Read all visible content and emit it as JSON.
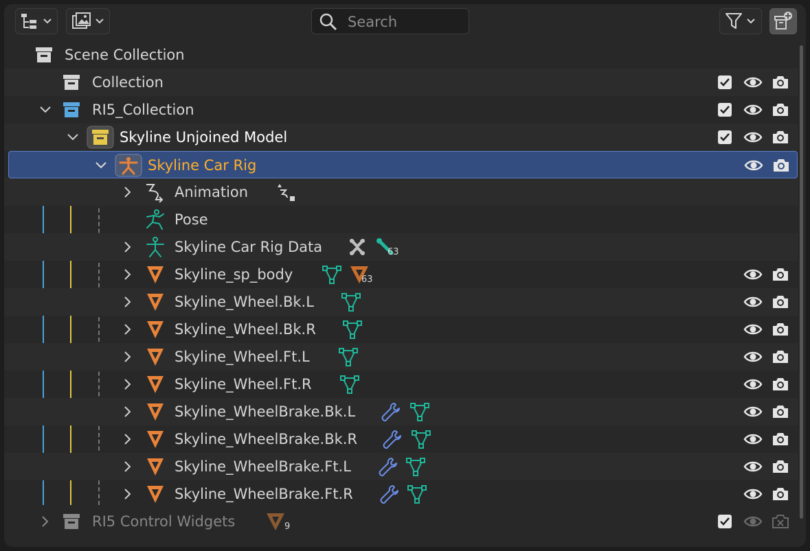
{
  "toolbar": {
    "display_mode_icon": "outliner-display-mode-icon",
    "filter_icon": "filter-funnel-icon",
    "new_collection_icon": "new-collection-icon",
    "search": {
      "placeholder": "Search",
      "value": ""
    }
  },
  "tree": [
    {
      "label": "Scene Collection",
      "icon": "collection-icon"
    },
    {
      "label": "Collection",
      "icon": "collection-icon",
      "toggles": [
        "checkbox",
        "eye",
        "camera"
      ]
    },
    {
      "label": "RI5_Collection",
      "icon": "collection-icon-blue",
      "toggles": [
        "checkbox",
        "eye",
        "camera"
      ]
    },
    {
      "label": "Skyline Unjoined Model",
      "icon": "collection-icon-yellow",
      "toggles": [
        "checkbox",
        "eye",
        "camera"
      ]
    },
    {
      "label": "Skyline Car Rig",
      "icon": "armature-icon",
      "selected": true,
      "toggles": [
        "eye",
        "camera"
      ]
    },
    {
      "label": "Animation",
      "icon": "action-icon",
      "extras": [
        "action-data-icon"
      ]
    },
    {
      "label": "Pose",
      "icon": "pose-icon"
    },
    {
      "label": "Skyline Car Rig Data",
      "icon": "armature-data-icon",
      "extras": [
        "bone-group-icon",
        "bone-icon"
      ],
      "extra_badge": "63"
    },
    {
      "label": "Skyline_sp_body",
      "icon": "mesh-object-icon",
      "extras": [
        "mesh-data-icon",
        "mesh-object-icon"
      ],
      "extra_badge": "63",
      "toggles": [
        "eye",
        "camera"
      ]
    },
    {
      "label": "Skyline_Wheel.Bk.L",
      "icon": "mesh-object-icon",
      "extras": [
        "mesh-data-icon"
      ],
      "toggles": [
        "eye",
        "camera"
      ]
    },
    {
      "label": "Skyline_Wheel.Bk.R",
      "icon": "mesh-object-icon",
      "extras": [
        "mesh-data-icon"
      ],
      "toggles": [
        "eye",
        "camera"
      ]
    },
    {
      "label": "Skyline_Wheel.Ft.L",
      "icon": "mesh-object-icon",
      "extras": [
        "mesh-data-icon"
      ],
      "toggles": [
        "eye",
        "camera"
      ]
    },
    {
      "label": "Skyline_Wheel.Ft.R",
      "icon": "mesh-object-icon",
      "extras": [
        "mesh-data-icon"
      ],
      "toggles": [
        "eye",
        "camera"
      ]
    },
    {
      "label": "Skyline_WheelBrake.Bk.L",
      "icon": "mesh-object-icon",
      "extras": [
        "modifier-wrench-icon",
        "mesh-data-icon"
      ],
      "toggles": [
        "eye",
        "camera"
      ]
    },
    {
      "label": "Skyline_WheelBrake.Bk.R",
      "icon": "mesh-object-icon",
      "extras": [
        "modifier-wrench-icon",
        "mesh-data-icon"
      ],
      "toggles": [
        "eye",
        "camera"
      ]
    },
    {
      "label": "Skyline_WheelBrake.Ft.L",
      "icon": "mesh-object-icon",
      "extras": [
        "modifier-wrench-icon",
        "mesh-data-icon"
      ],
      "toggles": [
        "eye",
        "camera"
      ]
    },
    {
      "label": "Skyline_WheelBrake.Ft.R",
      "icon": "mesh-object-icon",
      "extras": [
        "modifier-wrench-icon",
        "mesh-data-icon"
      ],
      "toggles": [
        "eye",
        "camera"
      ]
    },
    {
      "label": "RI5 Control Widgets",
      "icon": "collection-icon",
      "dimmed": true,
      "extras": [
        "mesh-object-icon"
      ],
      "extra_badge": "9",
      "toggles": [
        "checkbox",
        "eye-dim",
        "camera-disabled"
      ]
    }
  ],
  "colors": {
    "selection": "#334d80",
    "selected_text": "#ffaf29",
    "mesh_orange": "#e8833a",
    "mesh_data_green": "#1fb89a",
    "modifier_blue": "#6b8ee8",
    "collection_blue": "#5aa8e0",
    "collection_yellow": "#e8c84a",
    "tree_line_blue": "#4aa4dc",
    "tree_line_yellow": "#e0c840"
  }
}
